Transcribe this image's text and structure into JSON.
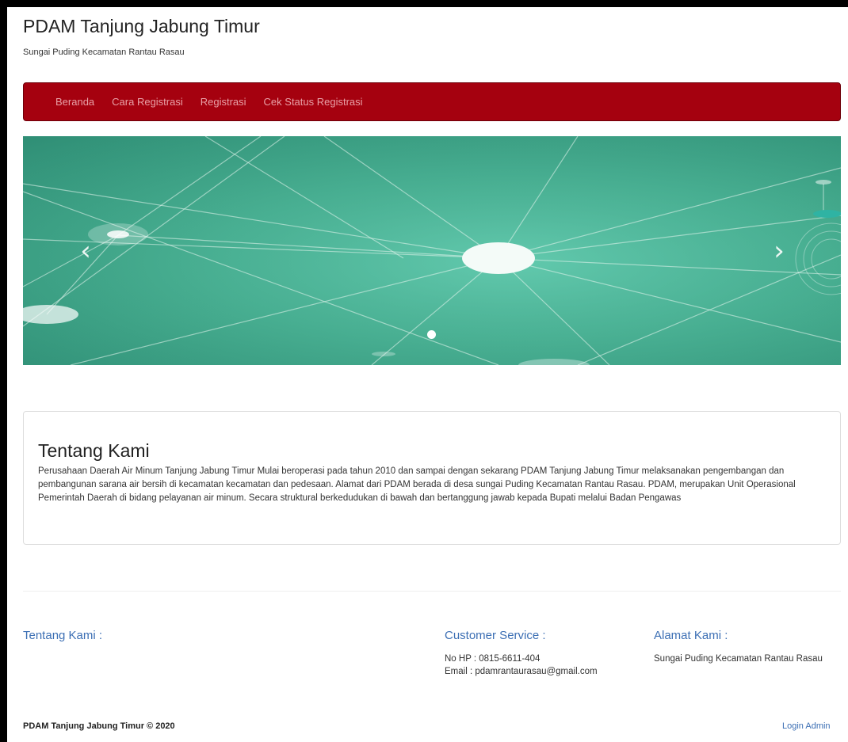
{
  "header": {
    "title": "PDAM Tanjung Jabung Timur",
    "subtitle": "Sungai Puding Kecamatan Rantau Rasau"
  },
  "nav": {
    "items": [
      "Beranda",
      "Cara Registrasi",
      "Registrasi",
      "Cek Status Registrasi"
    ],
    "background": "#a5010f"
  },
  "carousel": {
    "prev_icon": "chevron-left-icon",
    "next_icon": "chevron-right-icon",
    "slide_count": 1,
    "active_slide": 1,
    "background": "#48b092"
  },
  "about": {
    "heading": "Tentang Kami",
    "text": "Perusahaan Daerah Air Minum Tanjung Jabung Timur Mulai beroperasi pada tahun 2010 dan sampai dengan sekarang PDAM Tanjung Jabung Timur melaksanakan pengembangan dan pembangunan sarana air bersih di kecamatan kecamatan dan pedesaan. Alamat dari PDAM berada di desa sungai Puding Kecamatan Rantau Rasau. PDAM, merupakan Unit Operasional Pemerintah Daerah di bidang pelayanan air minum. Secara struktural berkedudukan di bawah dan bertanggung jawab kepada Bupati melalui Badan Pengawas"
  },
  "footer": {
    "about_heading": "Tentang Kami :",
    "cs_heading": "Customer Service :",
    "cs_phone": "No HP : 0815-6611-404",
    "cs_email": "Email : pdamrantaurasau@gmail.com",
    "address_heading": "Alamat Kami :",
    "address": "Sungai Puding Kecamatan Rantau Rasau",
    "copyright": "PDAM Tanjung Jabung Timur © 2020",
    "login_admin": "Login Admin",
    "link_color": "#3c6fb4"
  }
}
